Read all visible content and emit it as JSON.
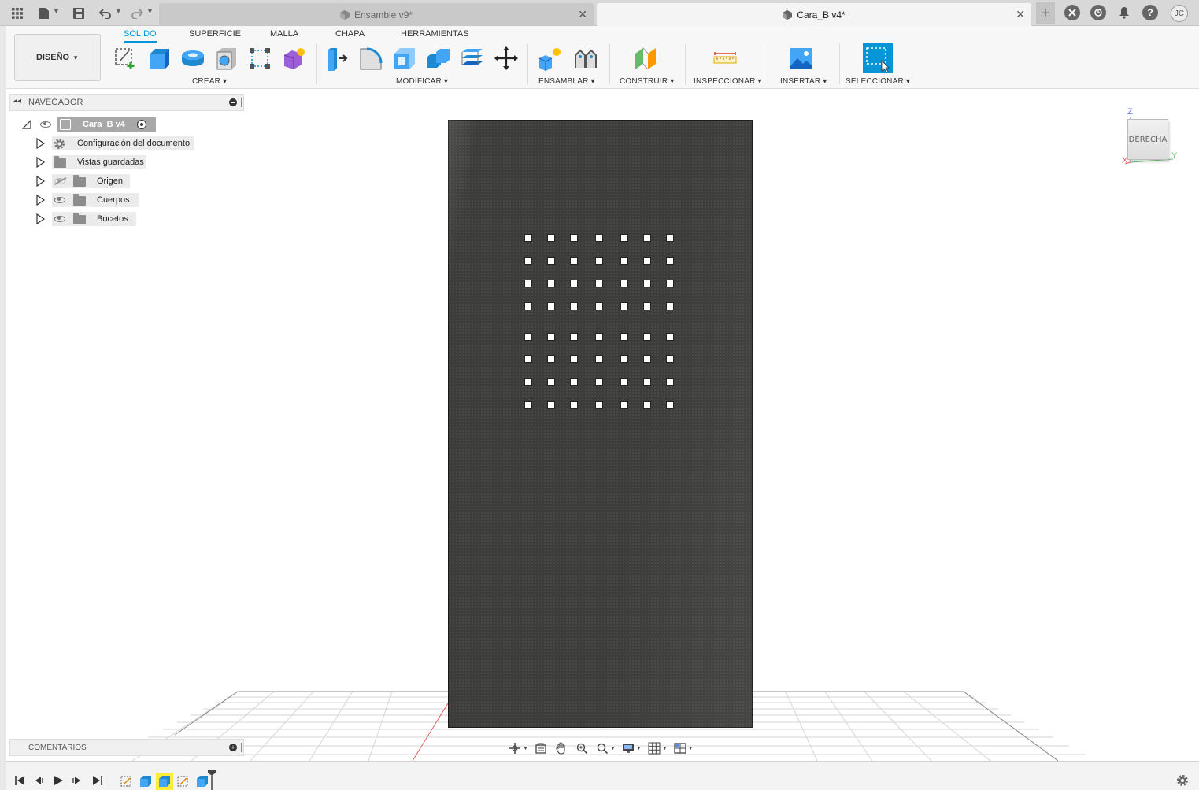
{
  "titlebar": {
    "tabs": [
      {
        "label": "Ensamble v9*",
        "active": false
      },
      {
        "label": "Cara_B v4*",
        "active": true
      }
    ],
    "user_initials": "JC"
  },
  "toolbar": {
    "workspace_label": "DISEÑO",
    "tabs": [
      "SOLIDO",
      "SUPERFICIE",
      "MALLA",
      "CHAPA",
      "HERRAMIENTAS"
    ],
    "active_tab": "SOLIDO",
    "groups": {
      "create": "CREAR",
      "modify": "MODIFICAR",
      "assemble": "ENSAMBLAR",
      "construct": "CONSTRUIR",
      "inspect": "INSPECCIONAR",
      "insert": "INSERTAR",
      "select": "SELECCIONAR"
    }
  },
  "navigator": {
    "title": "NAVEGADOR",
    "root": "Cara_B v4",
    "items": [
      {
        "label": "Configuración del documento",
        "icon": "gear-icon"
      },
      {
        "label": "Vistas guardadas",
        "icon": "folder-icon"
      },
      {
        "label": "Origen",
        "icon": "folder-icon",
        "visible": false
      },
      {
        "label": "Cuerpos",
        "icon": "folder-icon",
        "visible": true
      },
      {
        "label": "Bocetos",
        "icon": "folder-icon",
        "visible": true
      }
    ]
  },
  "comments": {
    "title": "COMENTARIOS"
  },
  "viewcube": {
    "face": "DERECHA",
    "axis_z": "Z",
    "axis_x": "X",
    "axis_y": "Y"
  },
  "model": {
    "hole_rows": 8,
    "hole_cols": 7
  },
  "colors": {
    "accent": "#0696d7",
    "model_face": "#3c3c3a",
    "grid": "#cfcfcf"
  }
}
